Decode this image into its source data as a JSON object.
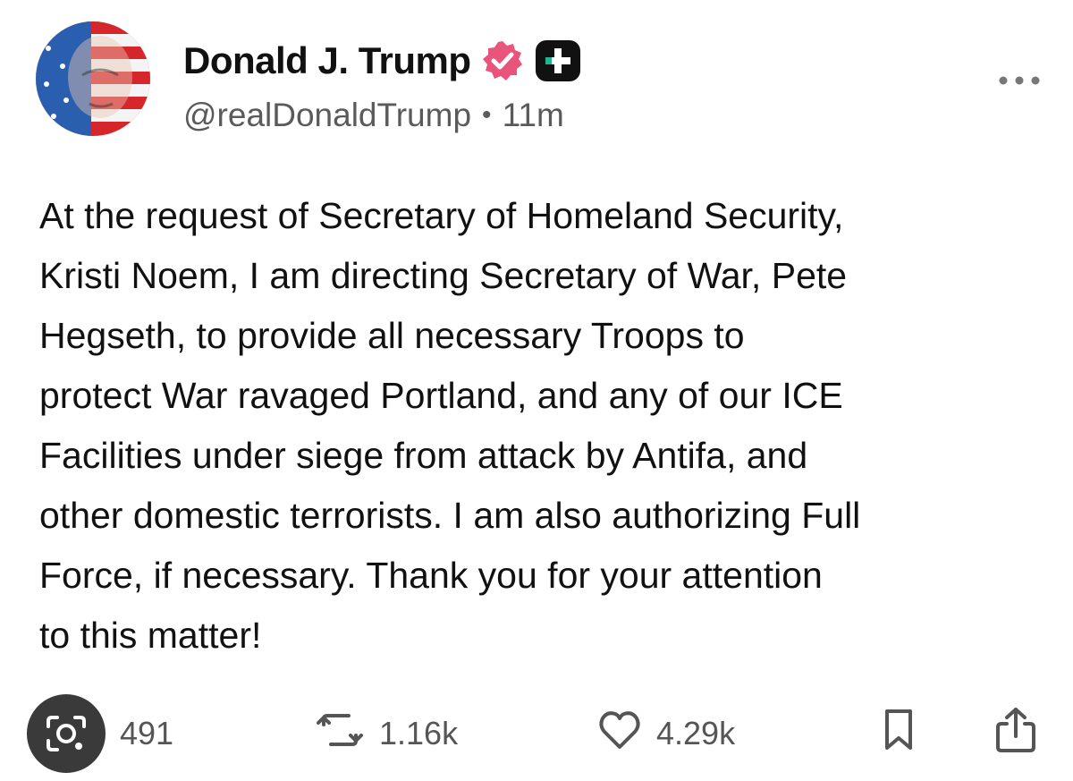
{
  "post": {
    "author": {
      "display_name": "Donald J. Trump",
      "handle": "@realDonaldTrump",
      "verified_icon": "verified-badge-icon",
      "badge_icon": "plus-badge-icon",
      "avatar_icon": "avatar-flag-portrait"
    },
    "time_separator": "•",
    "time_ago": "11m",
    "more_icon": "more-options-icon",
    "text": "At the request of Secretary of Homeland Security,\nKristi Noem, I am directing Secretary of War, Pete\nHegseth, to provide all necessary Troops to\nprotect War ravaged Portland, and any of our ICE\nFacilities under siege from attack by Antifa, and\nother domestic terrorists. I am also authorizing Full\nForce, if necessary. Thank you for your attention\nto this matter!",
    "actions": {
      "replies": "491",
      "reposts": "1.16k",
      "likes": "4.29k"
    }
  },
  "colors": {
    "verified": "#e8547a",
    "text": "#111111",
    "muted": "#5a5a5a",
    "lens_overlay": "#3a3a3a"
  }
}
